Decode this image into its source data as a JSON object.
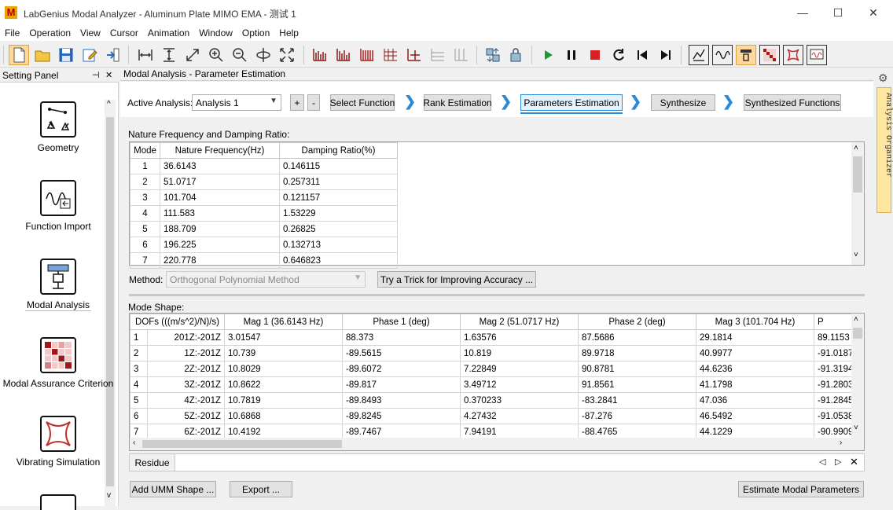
{
  "app": {
    "logo": "M",
    "title": "LabGenius Modal Analyzer - Aluminum Plate MIMO EMA - 测试 1",
    "minimize": "—",
    "maximize": "☐",
    "close": "✕"
  },
  "menu": [
    "File",
    "Operation",
    "View",
    "Cursor",
    "Animation",
    "Window",
    "Option",
    "Help"
  ],
  "left_panel": {
    "title": "Setting Panel",
    "pin": "⊣",
    "close": "✕",
    "items": [
      {
        "label": "Geometry",
        "icon": "geometry-icon"
      },
      {
        "label": "Function Import",
        "icon": "function-import-icon"
      },
      {
        "label": "Modal Analysis",
        "icon": "modal-analysis-icon"
      },
      {
        "label": "Modal Assurance Criterion",
        "icon": "mac-matrix-icon"
      },
      {
        "label": "Vibrating Simulation",
        "icon": "vibrating-simulation-icon"
      }
    ],
    "scroll_up": "^",
    "scroll_down": "v"
  },
  "main": {
    "title": "Modal Analysis - Parameter Estimation",
    "active_analysis_label": "Active Analysis:",
    "active_analysis_value": "Analysis 1",
    "add": "+",
    "remove": "-",
    "steps": [
      "Select Function",
      "Rank Estimation",
      "Parameters Estimation",
      "Synthesize",
      "Synthesized Functions"
    ],
    "nf_section_title": "Nature Frequency and Damping Ratio:",
    "nf_headers": [
      "Mode",
      "Nature Frequency(Hz)",
      "Damping Ratio(%)"
    ],
    "nf_rows": [
      [
        "1",
        "36.6143",
        "0.146115"
      ],
      [
        "2",
        "51.0717",
        "0.257311"
      ],
      [
        "3",
        "101.704",
        "0.121157"
      ],
      [
        "4",
        "111.583",
        "1.53229"
      ],
      [
        "5",
        "188.709",
        "0.26825"
      ],
      [
        "6",
        "196.225",
        "0.132713"
      ],
      [
        "7",
        "220.778",
        "0.646823"
      ]
    ],
    "method_label": "Method:",
    "method_value": "Orthogonal Polynomial Method",
    "trick_button": "Try a Trick for Improving Accuracy ...",
    "mode_shape_title": "Mode Shape:",
    "ms_headers": [
      "DOFs (((m/s^2)/N)/s)",
      "Mag 1 (36.6143 Hz)",
      "Phase 1 (deg)",
      "Mag 2 (51.0717 Hz)",
      "Phase 2 (deg)",
      "Mag 3 (101.704 Hz)",
      "P"
    ],
    "ms_rows": [
      [
        "1",
        "201Z:-201Z",
        "3.01547",
        "88.373",
        "1.63576",
        "87.5686",
        "29.1814",
        "89.1153"
      ],
      [
        "2",
        "1Z:-201Z",
        "10.739",
        "-89.5615",
        "10.819",
        "89.9718",
        "40.9977",
        "-91.0187"
      ],
      [
        "3",
        "2Z:-201Z",
        "10.8029",
        "-89.6072",
        "7.22849",
        "90.8781",
        "44.6236",
        "-91.3194"
      ],
      [
        "4",
        "3Z:-201Z",
        "10.8622",
        "-89.817",
        "3.49712",
        "91.8561",
        "41.1798",
        "-91.2803"
      ],
      [
        "5",
        "4Z:-201Z",
        "10.7819",
        "-89.8493",
        "0.370233",
        "-83.2841",
        "47.036",
        "-91.2845"
      ],
      [
        "6",
        "5Z:-201Z",
        "10.6868",
        "-89.8245",
        "4.27432",
        "-87.276",
        "46.5492",
        "-91.0538"
      ],
      [
        "7",
        "6Z:-201Z",
        "10.4192",
        "-89.7467",
        "7.94191",
        "-88.4765",
        "44.1229",
        "-90.9909"
      ]
    ],
    "residue_tab": "Residue",
    "add_umm": "Add UMM Shape ...",
    "export": "Export ...",
    "estimate": "Estimate Modal Parameters"
  },
  "organizer": {
    "label": "Analysis Organizer",
    "gear": "⚙"
  },
  "colors": {
    "accent": "#2b8ad6",
    "active_toolbar": "#ffd89a",
    "organizer_tab": "#ffe6a0"
  }
}
